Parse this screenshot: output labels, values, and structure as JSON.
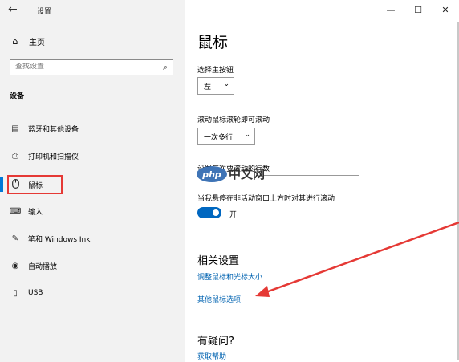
{
  "window": {
    "title": "设置",
    "controls": {
      "minimize": "—",
      "maximize": "☐",
      "close": "✕"
    }
  },
  "sidebar": {
    "home_label": "主页",
    "search_placeholder": "查找设置",
    "section_label": "设备",
    "items": [
      {
        "label": "蓝牙和其他设备",
        "icon": "bluetooth-devices-icon"
      },
      {
        "label": "打印机和扫描仪",
        "icon": "printer-icon"
      },
      {
        "label": "鼠标",
        "icon": "mouse-icon",
        "selected": true
      },
      {
        "label": "输入",
        "icon": "keyboard-icon"
      },
      {
        "label": "笔和 Windows Ink",
        "icon": "pen-icon"
      },
      {
        "label": "自动播放",
        "icon": "autoplay-icon"
      },
      {
        "label": "USB",
        "icon": "usb-icon"
      }
    ]
  },
  "main": {
    "title": "鼠标",
    "primary_button": {
      "label": "选择主按钮",
      "value": "左"
    },
    "scroll_wheel": {
      "label": "滚动鼠标滚轮即可滚动",
      "value": "一次多行"
    },
    "lines_to_scroll_label": "设置每次要滚动的行数",
    "inactive_scroll": {
      "label": "当我悬停在非活动窗口上方时对其进行滚动",
      "state": "开"
    },
    "related": {
      "heading": "相关设置",
      "links": [
        "调整鼠标和光标大小",
        "其他鼠标选项"
      ]
    },
    "help": {
      "heading": "有疑问?",
      "link": "获取帮助"
    }
  },
  "watermark": {
    "logo": "php",
    "text": "中文网"
  },
  "colors": {
    "accent": "#0078d7",
    "annotation": "#e53935",
    "link": "#0063b1"
  }
}
